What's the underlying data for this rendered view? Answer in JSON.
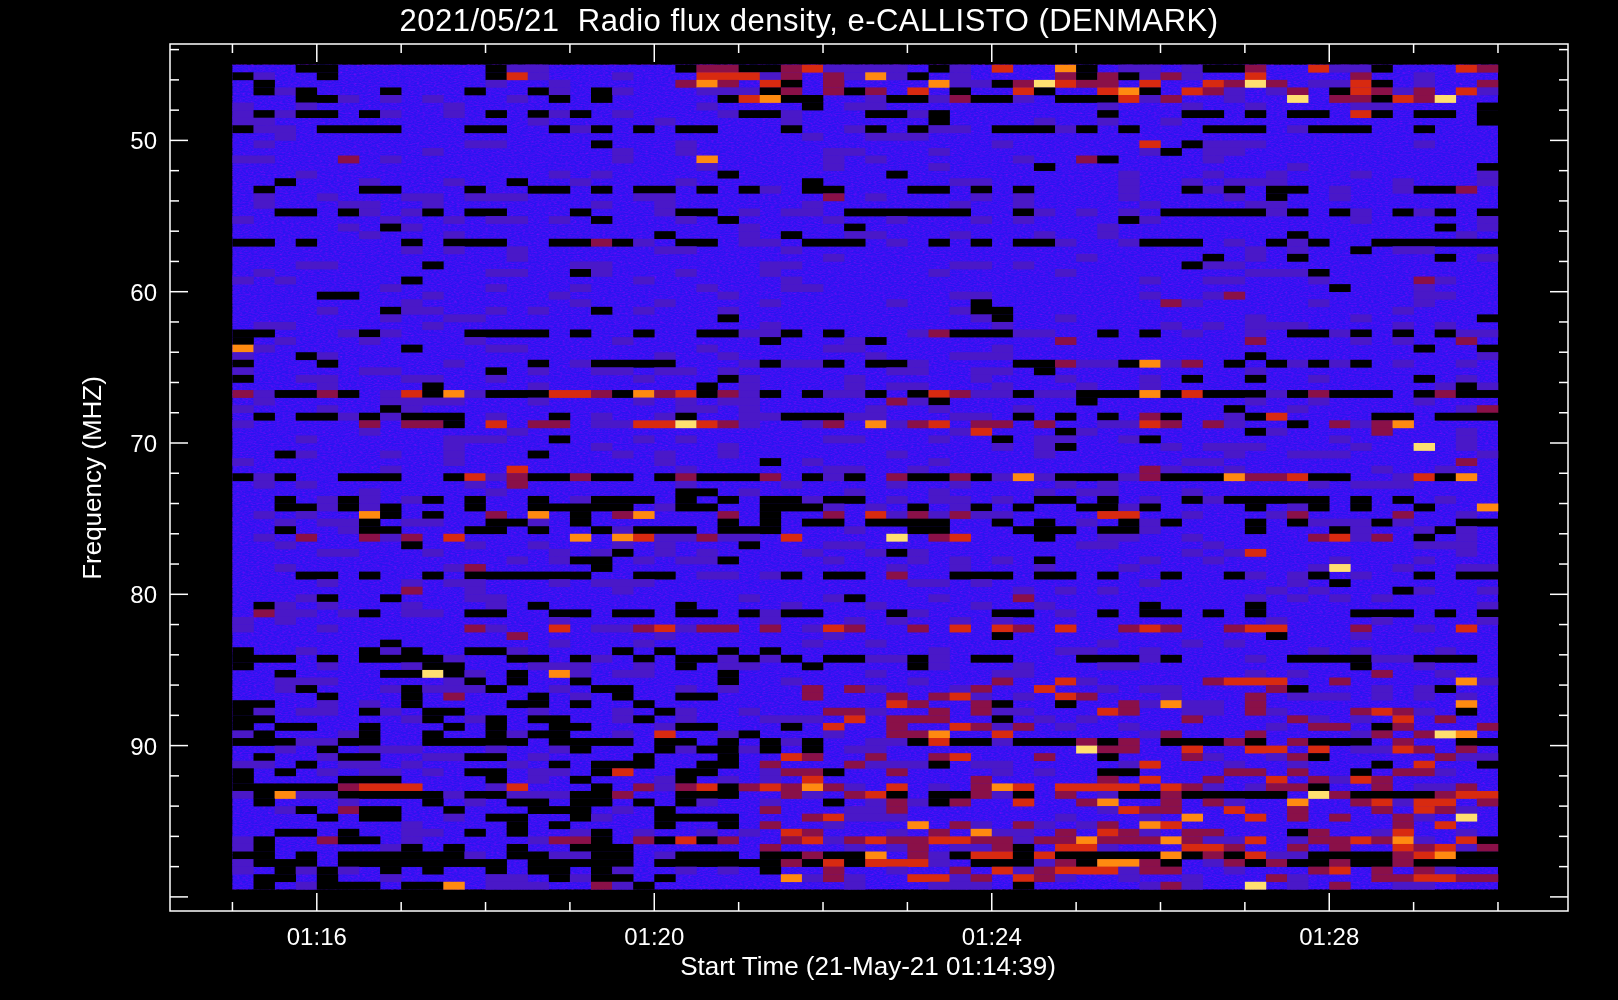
{
  "plot": {
    "title": "2021/05/21  Radio flux density, e-CALLISTO (DENMARK)",
    "ylabel": "Frequency (MHZ)",
    "xlabel": "Start Time (21-May-21 01:14:39)",
    "yticks": [
      "50",
      "60",
      "70",
      "80",
      "90"
    ],
    "xticks": [
      "01:16",
      "01:20",
      "01:24",
      "01:28"
    ]
  }
}
